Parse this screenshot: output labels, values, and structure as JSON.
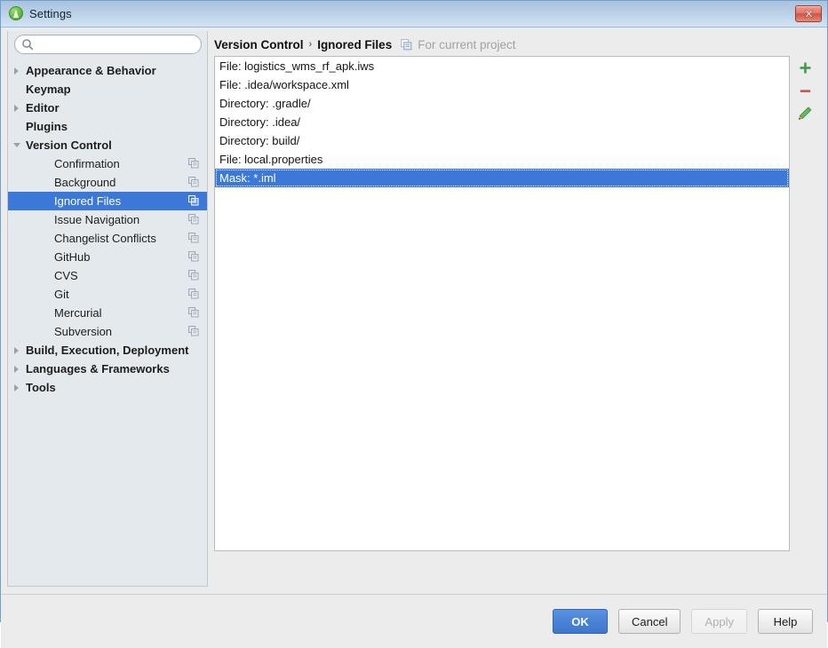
{
  "window": {
    "title": "Settings",
    "app_icon": "android-studio-icon",
    "close_label": "close-icon",
    "accent_blue": "#3c78d8",
    "titlebar_blue": "#b7cee5",
    "close_red": "#cf5340"
  },
  "search": {
    "value": "",
    "placeholder": "",
    "icon": "search-icon"
  },
  "sidebar": {
    "items": [
      {
        "label": "Appearance & Behavior",
        "level": 0,
        "arrow": "right",
        "selected": false,
        "project_icon": false
      },
      {
        "label": "Keymap",
        "level": 0,
        "arrow": "none",
        "selected": false,
        "project_icon": false
      },
      {
        "label": "Editor",
        "level": 0,
        "arrow": "right",
        "selected": false,
        "project_icon": false
      },
      {
        "label": "Plugins",
        "level": 0,
        "arrow": "none",
        "selected": false,
        "project_icon": false
      },
      {
        "label": "Version Control",
        "level": 0,
        "arrow": "down",
        "selected": false,
        "project_icon": false
      },
      {
        "label": "Confirmation",
        "level": 1,
        "arrow": "none",
        "selected": false,
        "project_icon": true
      },
      {
        "label": "Background",
        "level": 1,
        "arrow": "none",
        "selected": false,
        "project_icon": true
      },
      {
        "label": "Ignored Files",
        "level": 1,
        "arrow": "none",
        "selected": true,
        "project_icon": true
      },
      {
        "label": "Issue Navigation",
        "level": 1,
        "arrow": "none",
        "selected": false,
        "project_icon": true
      },
      {
        "label": "Changelist Conflicts",
        "level": 1,
        "arrow": "none",
        "selected": false,
        "project_icon": true
      },
      {
        "label": "GitHub",
        "level": 1,
        "arrow": "none",
        "selected": false,
        "project_icon": true
      },
      {
        "label": "CVS",
        "level": 1,
        "arrow": "none",
        "selected": false,
        "project_icon": true
      },
      {
        "label": "Git",
        "level": 1,
        "arrow": "none",
        "selected": false,
        "project_icon": true
      },
      {
        "label": "Mercurial",
        "level": 1,
        "arrow": "none",
        "selected": false,
        "project_icon": true
      },
      {
        "label": "Subversion",
        "level": 1,
        "arrow": "none",
        "selected": false,
        "project_icon": true
      },
      {
        "label": "Build, Execution, Deployment",
        "level": 0,
        "arrow": "right",
        "selected": false,
        "project_icon": false
      },
      {
        "label": "Languages & Frameworks",
        "level": 0,
        "arrow": "right",
        "selected": false,
        "project_icon": false
      },
      {
        "label": "Tools",
        "level": 0,
        "arrow": "right",
        "selected": false,
        "project_icon": false
      }
    ]
  },
  "breadcrumb": {
    "parent": "Version Control",
    "separator": "›",
    "current": "Ignored Files",
    "scope_icon": "project-scope-icon",
    "scope_note": "For current project"
  },
  "ignored_list": {
    "rows": [
      {
        "label": "File: logistics_wms_rf_apk.iws",
        "selected": false
      },
      {
        "label": "File: .idea/workspace.xml",
        "selected": false
      },
      {
        "label": "Directory: .gradle/",
        "selected": false
      },
      {
        "label": "Directory: .idea/",
        "selected": false
      },
      {
        "label": "Directory: build/",
        "selected": false
      },
      {
        "label": "File: local.properties",
        "selected": false
      },
      {
        "label": "Mask: *.iml",
        "selected": true
      }
    ]
  },
  "list_toolbar": {
    "add": {
      "icon": "plus-icon",
      "title": "Add"
    },
    "remove": {
      "icon": "minus-icon",
      "title": "Remove"
    },
    "edit": {
      "icon": "pencil-icon",
      "title": "Edit"
    }
  },
  "footer": {
    "buttons": [
      {
        "label": "OK",
        "style": "default",
        "disabled": false
      },
      {
        "label": "Cancel",
        "style": "normal",
        "disabled": false
      },
      {
        "label": "Apply",
        "style": "normal",
        "disabled": true
      },
      {
        "label": "Help",
        "style": "normal",
        "disabled": false
      }
    ]
  }
}
